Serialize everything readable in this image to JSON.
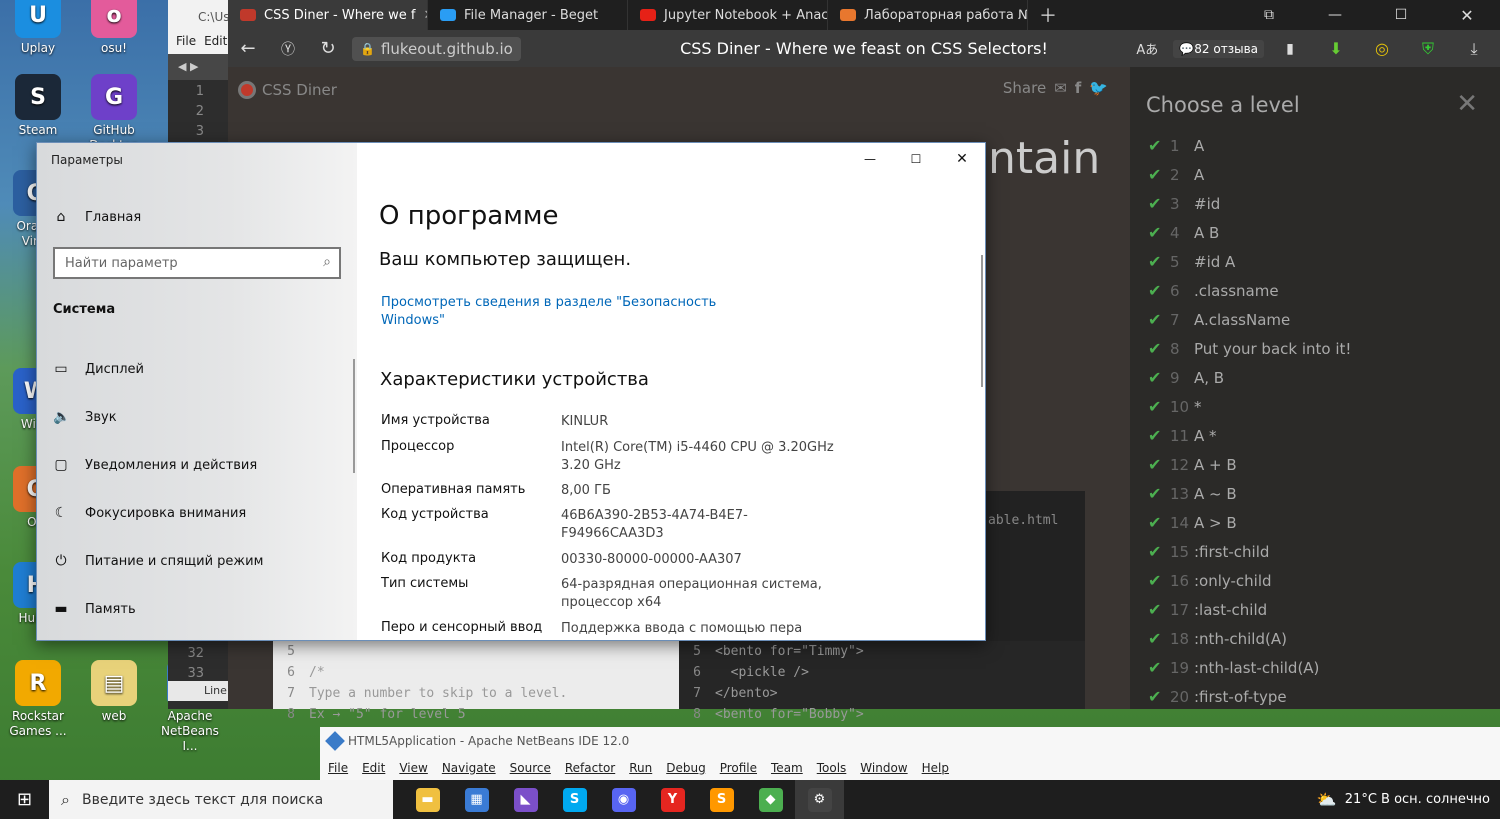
{
  "desktop": {
    "icons": [
      {
        "label": "Uplay",
        "color": "#1b8ee0",
        "glyph": "U"
      },
      {
        "label": "osu!",
        "color": "#e35b9b",
        "glyph": "o"
      },
      {
        "label": "Steam",
        "color": "#1b2838",
        "glyph": "S"
      },
      {
        "label": "GitHub\nDesktop",
        "color": "#6e40c9",
        "glyph": "G"
      },
      {
        "label": "Oracle\nVirtu",
        "color": "#2c5fa0",
        "glyph": "O"
      },
      {
        "label": "Wind",
        "color": "#2a62c9",
        "glyph": "W"
      },
      {
        "label": "Ori",
        "color": "#e0702a",
        "glyph": "O"
      },
      {
        "label": "Huion",
        "color": "#1f7ed3",
        "glyph": "H"
      },
      {
        "label": "Rockstar\nGames ...",
        "color": "#f2a900",
        "glyph": "R"
      },
      {
        "label": "web",
        "color": "#e8d27a",
        "glyph": "▤"
      },
      {
        "label": "Apache\nNetBeans I...",
        "color": "#3a7bc8",
        "glyph": "N"
      }
    ]
  },
  "editor_bg": {
    "path": "C:\\Us",
    "menu": [
      "File",
      "Edit"
    ],
    "line_numbers_top": [
      "1",
      "2",
      "3"
    ],
    "line_numbers_bottom": [
      "32",
      "33"
    ],
    "status": "Line"
  },
  "browser": {
    "tabs": [
      {
        "label": "CSS Diner - Where we f",
        "color": "#c0392b",
        "active": true
      },
      {
        "label": "File Manager - Beget",
        "color": "#2a9df4",
        "active": false
      },
      {
        "label": "Jupyter Notebook + Anac",
        "color": "#e62117",
        "active": false
      },
      {
        "label": "Лабораторная работа №",
        "color": "#e8772e",
        "active": false
      }
    ],
    "url": "flukeout.github.io",
    "page_title": "CSS Diner - Where we feast on CSS Selectors!",
    "reviews": "82 отзыва",
    "site_name": "CSS Diner",
    "share_label": "Share",
    "heading_fragment": "ntain",
    "editor_file": "able.html",
    "left_code": [
      {
        "n": "5",
        "t": ""
      },
      {
        "n": "6",
        "t": "/*"
      },
      {
        "n": "7",
        "t": "Type a number to skip to a level."
      },
      {
        "n": "8",
        "t": "Ex → \"5\" for level 5"
      }
    ],
    "right_code": [
      {
        "n": "5",
        "t": "<bento for=\"Timmy\">"
      },
      {
        "n": "6",
        "t": "  <pickle />"
      },
      {
        "n": "7",
        "t": "</bento>"
      },
      {
        "n": "8",
        "t": "<bento for=\"Bobby\">"
      }
    ],
    "levels_title": "Choose a level",
    "levels": [
      {
        "n": "1",
        "label": "A"
      },
      {
        "n": "2",
        "label": "A"
      },
      {
        "n": "3",
        "label": "#id"
      },
      {
        "n": "4",
        "label": "A  B"
      },
      {
        "n": "5",
        "label": "#id  A"
      },
      {
        "n": "6",
        "label": ".classname"
      },
      {
        "n": "7",
        "label": "A.className"
      },
      {
        "n": "8",
        "label": "Put your back into it!"
      },
      {
        "n": "9",
        "label": "A, B"
      },
      {
        "n": "10",
        "label": "*"
      },
      {
        "n": "11",
        "label": "A  *"
      },
      {
        "n": "12",
        "label": "A + B"
      },
      {
        "n": "13",
        "label": "A ~ B"
      },
      {
        "n": "14",
        "label": "A > B"
      },
      {
        "n": "15",
        "label": ":first-child"
      },
      {
        "n": "16",
        "label": ":only-child"
      },
      {
        "n": "17",
        "label": ":last-child"
      },
      {
        "n": "18",
        "label": ":nth-child(A)"
      },
      {
        "n": "19",
        "label": ":nth-last-child(A)"
      },
      {
        "n": "20",
        "label": ":first-of-type"
      }
    ]
  },
  "settings": {
    "window_title": "Параметры",
    "home": "Главная",
    "search_placeholder": "Найти параметр",
    "section": "Система",
    "nav": [
      {
        "label": "Дисплей",
        "glyph": "▭"
      },
      {
        "label": "Звук",
        "glyph": "🔈"
      },
      {
        "label": "Уведомления и действия",
        "glyph": "▢"
      },
      {
        "label": "Фокусировка внимания",
        "glyph": "☾"
      },
      {
        "label": "Питание и спящий режим",
        "glyph": "⏻"
      },
      {
        "label": "Память",
        "glyph": "▬"
      }
    ],
    "page_title": "О программе",
    "protected": "Ваш компьютер защищен.",
    "security_link": "Просмотреть сведения в разделе \"Безопасность\nWindows\"",
    "specs_title": "Характеристики устройства",
    "specs": [
      {
        "k": "Имя устройства",
        "v": "KINLUR"
      },
      {
        "k": "Процессор",
        "v": "Intel(R) Core(TM) i5-4460  CPU @ 3.20GHz\n3.20 GHz"
      },
      {
        "k": "Оперативная память",
        "v": "8,00 ГБ"
      },
      {
        "k": "Код устройства",
        "v": "46B6A390-2B53-4A74-B4E7-\nF94966CAA3D3"
      },
      {
        "k": "Код продукта",
        "v": "00330-80000-00000-AA307"
      },
      {
        "k": "Тип системы",
        "v": "64-разрядная операционная система,\nпроцессор x64"
      },
      {
        "k": "Перо и сенсорный ввод",
        "v": "Поддержка ввода с помощью пера"
      }
    ]
  },
  "netbeans": {
    "title": "HTML5Application - Apache NetBeans IDE 12.0",
    "menu": [
      "File",
      "Edit",
      "View",
      "Navigate",
      "Source",
      "Refactor",
      "Run",
      "Debug",
      "Profile",
      "Team",
      "Tools",
      "Window",
      "Help"
    ]
  },
  "taskbar": {
    "search_placeholder": "Введите здесь текст для поиска",
    "apps": [
      {
        "name": "file-explorer-icon",
        "color": "#f0c040",
        "glyph": "▬"
      },
      {
        "name": "store-icon",
        "color": "#3a7bd5",
        "glyph": "▦"
      },
      {
        "name": "visual-studio-icon",
        "color": "#7b4fc9",
        "glyph": "◣"
      },
      {
        "name": "skype-icon",
        "color": "#00a9f0",
        "glyph": "S"
      },
      {
        "name": "discord-icon",
        "color": "#5865f2",
        "glyph": "◉"
      },
      {
        "name": "yandex-browser-icon",
        "color": "#e52620",
        "glyph": "Y"
      },
      {
        "name": "sublime-text-icon",
        "color": "#ff9800",
        "glyph": "S"
      },
      {
        "name": "netbeans-icon",
        "color": "#4caf50",
        "glyph": "◆"
      },
      {
        "name": "settings-icon",
        "color": "#444",
        "glyph": "⚙"
      }
    ],
    "weather": "21°C  В осн. солнечно"
  }
}
